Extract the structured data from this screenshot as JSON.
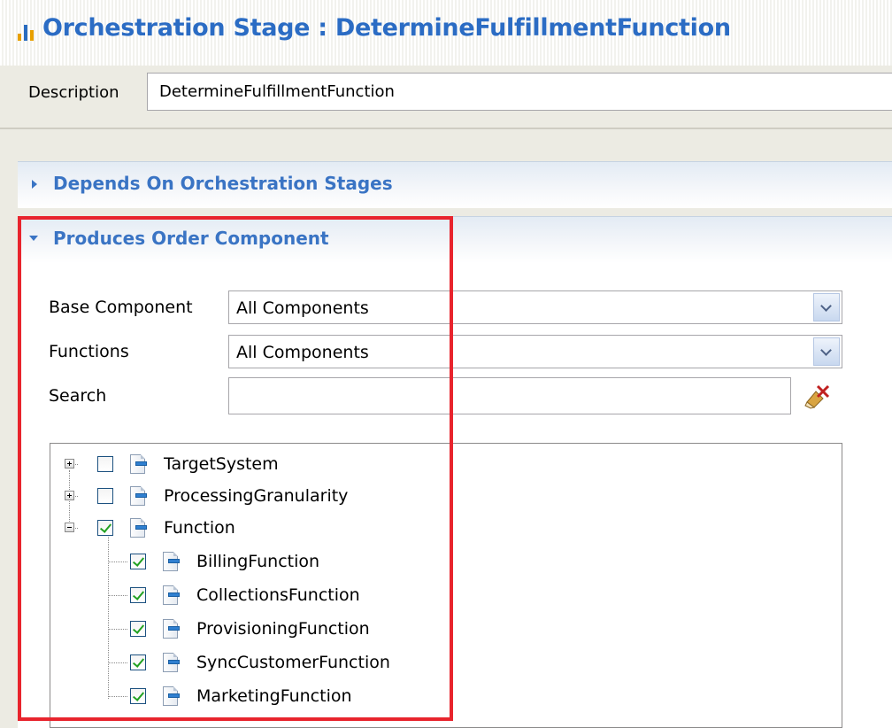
{
  "header": {
    "title": "Orchestration Stage : DetermineFulfillmentFunction",
    "icon": "bar-chart-icon"
  },
  "description": {
    "label": "Description",
    "value": "DetermineFulfillmentFunction"
  },
  "sections": {
    "depends_on": {
      "title": "Depends On Orchestration Stages",
      "expanded": false
    },
    "produces": {
      "title": "Produces Order Component",
      "expanded": true
    }
  },
  "filters": {
    "base_component": {
      "label": "Base Component",
      "value": "All Components"
    },
    "functions": {
      "label": "Functions",
      "value": "All Components"
    },
    "search": {
      "label": "Search",
      "value": "",
      "clear_icon": "clear-search-icon"
    }
  },
  "tree": {
    "nodes": [
      {
        "label": "TargetSystem",
        "checked": false,
        "expander": "plus"
      },
      {
        "label": "ProcessingGranularity",
        "checked": false,
        "expander": "plus"
      },
      {
        "label": "Function",
        "checked": true,
        "expander": "minus"
      }
    ],
    "children": [
      {
        "label": "BillingFunction",
        "checked": true
      },
      {
        "label": "CollectionsFunction",
        "checked": true
      },
      {
        "label": "ProvisioningFunction",
        "checked": true
      },
      {
        "label": "SyncCustomerFunction",
        "checked": true
      },
      {
        "label": "MarketingFunction",
        "checked": true
      }
    ]
  },
  "colors": {
    "accent": "#2b6cc4",
    "highlight": "#e8242d",
    "form_bg": "#ecebe3",
    "check": "#21a121"
  }
}
